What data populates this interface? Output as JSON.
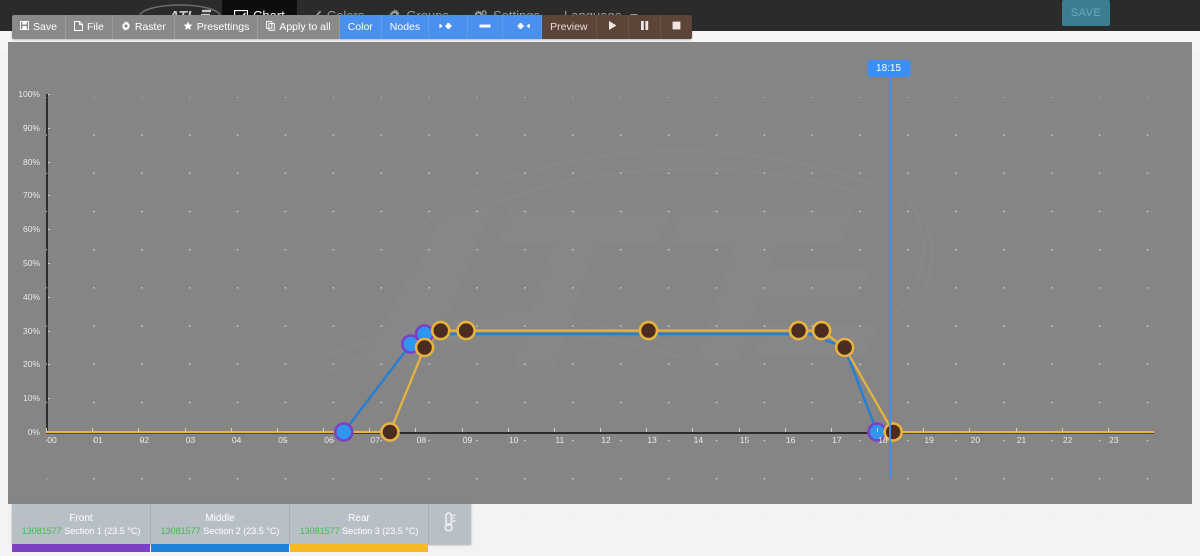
{
  "topnav": {
    "logo_alt": "ati-logo",
    "items": [
      {
        "label": "Chart",
        "icon": "chart-line-icon",
        "active": true
      },
      {
        "label": "Colors",
        "icon": "brush-icon",
        "active": false
      },
      {
        "label": "Groups",
        "icon": "gear-icon",
        "active": false
      },
      {
        "label": "Settings",
        "icon": "gears-icon",
        "active": false
      },
      {
        "label": "Language",
        "icon": "none",
        "active": false,
        "caret": true
      }
    ],
    "save_label": "SAVE",
    "save_color": "#3c7d91"
  },
  "toolbar": {
    "buttons": [
      {
        "label": "Save",
        "icon": "floppy-icon",
        "style": "grey"
      },
      {
        "label": "File",
        "icon": "file-icon",
        "style": "grey"
      },
      {
        "label": "Raster",
        "icon": "gear-icon",
        "style": "grey"
      },
      {
        "label": "Presettings",
        "icon": "star-icon",
        "style": "grey"
      },
      {
        "label": "Apply to all",
        "icon": "copy-icon",
        "style": "grey"
      },
      {
        "label": "Color",
        "icon": "none",
        "style": "blue"
      },
      {
        "label": "Nodes",
        "icon": "none",
        "style": "blue"
      },
      {
        "label": "◂✚",
        "icon": "add-left-icon",
        "style": "blue"
      },
      {
        "label": "▬",
        "icon": "remove-icon",
        "style": "blue"
      },
      {
        "label": "✚▸",
        "icon": "add-right-icon",
        "style": "blue"
      },
      {
        "label": "Preview",
        "icon": "none",
        "style": "brown"
      },
      {
        "label": "▶",
        "icon": "play-icon",
        "style": "brown"
      },
      {
        "label": "❚❚",
        "icon": "pause-icon",
        "style": "brown"
      },
      {
        "label": "■",
        "icon": "stop-icon",
        "style": "brown"
      }
    ]
  },
  "marker": {
    "time_label": "18:15",
    "x_hour": 18.25,
    "color": "#3b8ef5"
  },
  "sections": [
    {
      "name": "Front",
      "id": "13081577",
      "sub": "Section 1 (23.5 °C)",
      "color": "#7d3fc4"
    },
    {
      "name": "Middle",
      "id": "13081577",
      "sub": "Section 2 (23.5 °C)",
      "color": "#1e82d6"
    },
    {
      "name": "Rear",
      "id": "13081577",
      "sub": "Section 3 (23.5 °C)",
      "color": "#f5b925"
    }
  ],
  "thermo_icon": "thermometer-icon",
  "chart_data": {
    "type": "line",
    "title": "",
    "xlabel": "",
    "ylabel": "",
    "xlim": [
      0,
      24
    ],
    "ylim": [
      0,
      100
    ],
    "grid": "dots",
    "x_ticks": [
      "00",
      "01",
      "02",
      "03",
      "04",
      "05",
      "06",
      "07",
      "08",
      "09",
      "10",
      "11",
      "12",
      "13",
      "14",
      "15",
      "16",
      "17",
      "18",
      "19",
      "20",
      "21",
      "22",
      "23"
    ],
    "y_ticks": [
      "0%",
      "10%",
      "20%",
      "30%",
      "40%",
      "50%",
      "60%",
      "70%",
      "80%",
      "90%",
      "100%"
    ],
    "series": [
      {
        "name": "Front",
        "color": "#7d3fc4",
        "node_fill": "#2f95ee",
        "points": [
          {
            "x": 0,
            "y": 0
          },
          {
            "x": 6.45,
            "y": 0,
            "node": true
          },
          {
            "x": 7.9,
            "y": 26,
            "node": true
          },
          {
            "x": 8.2,
            "y": 29,
            "node": true
          },
          {
            "x": 16.55,
            "y": 29
          },
          {
            "x": 17.3,
            "y": 25,
            "node": true
          },
          {
            "x": 18.0,
            "y": 0,
            "node": true
          },
          {
            "x": 24,
            "y": 0
          }
        ]
      },
      {
        "name": "Middle",
        "color": "#1e82d6",
        "node_fill": "#2f95ee",
        "points": [
          {
            "x": 0,
            "y": 0
          },
          {
            "x": 6.45,
            "y": 0
          },
          {
            "x": 7.9,
            "y": 26
          },
          {
            "x": 8.2,
            "y": 29
          },
          {
            "x": 16.55,
            "y": 29
          },
          {
            "x": 17.3,
            "y": 25
          },
          {
            "x": 18.0,
            "y": 0
          },
          {
            "x": 24,
            "y": 0
          }
        ]
      },
      {
        "name": "Rear",
        "color": "#e8b43c",
        "node_fill": "#4a2c20",
        "points": [
          {
            "x": 0,
            "y": 0
          },
          {
            "x": 7.45,
            "y": 0,
            "node": true
          },
          {
            "x": 8.2,
            "y": 25,
            "node": true
          },
          {
            "x": 8.55,
            "y": 30,
            "node": true
          },
          {
            "x": 9.1,
            "y": 30,
            "node": true
          },
          {
            "x": 13.05,
            "y": 30,
            "node": true
          },
          {
            "x": 16.3,
            "y": 30,
            "node": true
          },
          {
            "x": 16.8,
            "y": 30,
            "node": true
          },
          {
            "x": 17.3,
            "y": 25,
            "node": true
          },
          {
            "x": 18.35,
            "y": 0,
            "node": true
          },
          {
            "x": 24,
            "y": 0
          }
        ]
      }
    ]
  }
}
